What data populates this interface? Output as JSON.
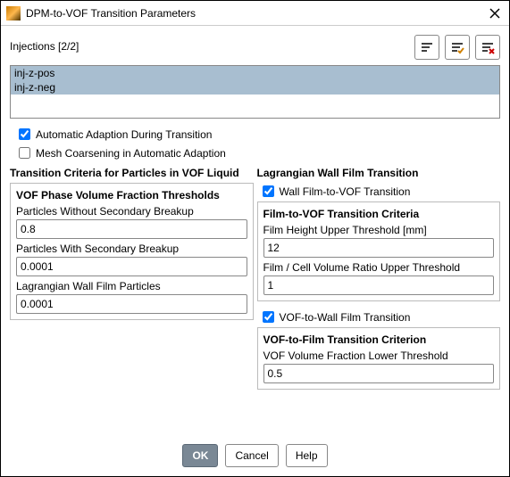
{
  "window": {
    "title": "DPM-to-VOF Transition Parameters"
  },
  "injections": {
    "label": "Injections [2/2]",
    "items": [
      "inj-z-pos",
      "inj-z-neg"
    ]
  },
  "checkboxes": {
    "auto_adapt": {
      "label": "Automatic Adaption During Transition",
      "checked": true
    },
    "mesh_coarsen": {
      "label": "Mesh Coarsening in Automatic Adaption",
      "checked": false
    }
  },
  "left": {
    "title": "Transition Criteria for Particles in VOF Liquid",
    "group_title": "VOF Phase Volume Fraction Thresholds",
    "f1": {
      "label": "Particles Without Secondary Breakup",
      "value": "0.8"
    },
    "f2": {
      "label": "Particles With Secondary Breakup",
      "value": "0.0001"
    },
    "f3": {
      "label": "Lagrangian Wall Film Particles",
      "value": "0.0001"
    }
  },
  "right": {
    "title": "Lagrangian Wall Film Transition",
    "cb_wall_to_vof": {
      "label": "Wall Film-to-VOF Transition",
      "checked": true
    },
    "group1_title": "Film-to-VOF Transition Criteria",
    "g1f1": {
      "label": "Film Height Upper Threshold [mm]",
      "value": "12"
    },
    "g1f2": {
      "label": "Film / Cell Volume Ratio Upper Threshold",
      "value": "1"
    },
    "cb_vof_to_wall": {
      "label": "VOF-to-Wall Film Transition",
      "checked": true
    },
    "group2_title": "VOF-to-Film Transition Criterion",
    "g2f1": {
      "label": "VOF Volume Fraction Lower Threshold",
      "value": "0.5"
    }
  },
  "buttons": {
    "ok": "OK",
    "cancel": "Cancel",
    "help": "Help"
  },
  "icons": {
    "list1": "list-icon",
    "list2": "list-check-icon",
    "list3": "list-delete-icon"
  }
}
